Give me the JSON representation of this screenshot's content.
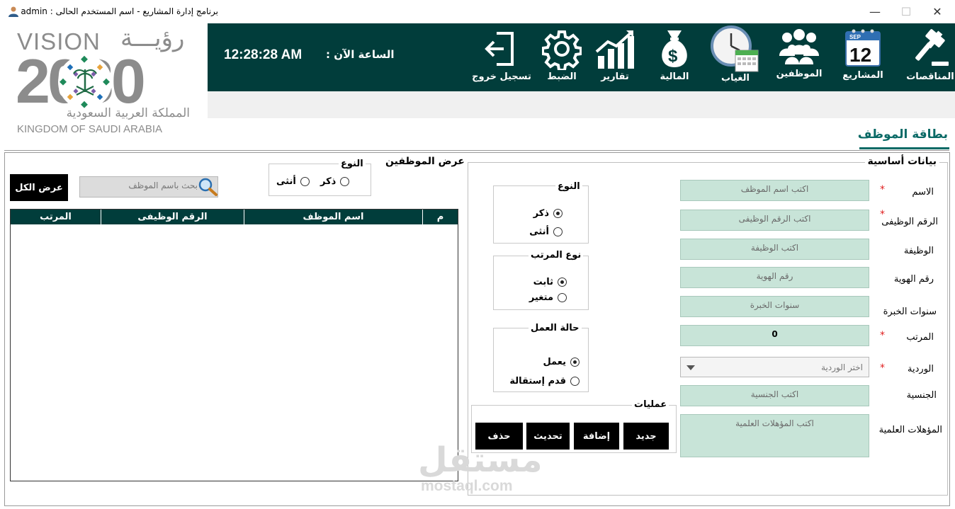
{
  "window": {
    "title": "برنامج إدارة المشاريع   -   اسم المستخدم الحالى  :   admin",
    "minimize": "—",
    "maximize": "☐",
    "close": "✕"
  },
  "toolbar": {
    "items": [
      {
        "label": "المناقصات",
        "icon": "gavel-icon"
      },
      {
        "label": "المشاريع",
        "icon": "calendar-icon"
      },
      {
        "label": "الموظفين",
        "icon": "users-icon"
      },
      {
        "label": "الغياب",
        "icon": "clock-calendar-icon"
      },
      {
        "label": "المالية",
        "icon": "money-bag-icon"
      },
      {
        "label": "تقارير",
        "icon": "chart-icon"
      },
      {
        "label": "الضبط",
        "icon": "gear-icon"
      },
      {
        "label": "تسجيل خروج",
        "icon": "logout-icon"
      }
    ],
    "calendar_month": "SEP",
    "calendar_day": "12",
    "clock_label": "الساعة الآن  :",
    "clock_time": "12:28:28 AM"
  },
  "logo": {
    "line1": "VISION",
    "line1_ar": "رؤيـــة",
    "number": "2030",
    "ar_name": "المملكة العربية السعودية",
    "en_name": "KINGDOM OF SAUDI ARABIA"
  },
  "page_title": "بطاقة الموظف",
  "employee_form": {
    "section_title": "بيانات أساسية",
    "fields": {
      "name": {
        "label": "الاسم",
        "placeholder": "اكتب اسم الموظف",
        "required": true
      },
      "emp_no": {
        "label": "الرقم الوظيفى",
        "placeholder": "اكتب الرقم الوظيفى",
        "required": true
      },
      "job": {
        "label": "الوظيفة",
        "placeholder": "اكتب الوظيفة"
      },
      "id_no": {
        "label": "رقم الهوية",
        "placeholder": "رقم الهوية"
      },
      "experience": {
        "label": "سنوات الخبرة",
        "placeholder": "سنوات الخبرة"
      },
      "salary": {
        "label": "المرتب",
        "value": "0",
        "required": true
      },
      "shift": {
        "label": "الوردية",
        "placeholder": "اختر الوردية",
        "required": true
      },
      "nationality": {
        "label": "الجنسية",
        "placeholder": "اكتب الجنسية"
      },
      "qualifications": {
        "label": "المؤهلات العلمية",
        "placeholder": "اكتب المؤهلات العلمية"
      }
    },
    "required_mark": "*",
    "gender_group": {
      "title": "النوع",
      "male": "ذكر",
      "female": "أنثى",
      "selected": "male"
    },
    "salary_type_group": {
      "title": "نوع المرتب",
      "fixed": "ثابت",
      "variable": "متغير",
      "selected": "fixed"
    },
    "work_status_group": {
      "title": "حالة العمل",
      "working": "يعمل",
      "resigned": "قدم إستقالة",
      "selected": "working"
    },
    "operations": {
      "title": "عمليات",
      "new": "جديد",
      "add": "إضافة",
      "update": "تحديث",
      "delete": "حذف"
    }
  },
  "employee_list": {
    "section_title": "عرض الموظفين",
    "gender_filter": {
      "title": "النوع",
      "male": "ذكر",
      "female": "أنثى"
    },
    "search_placeholder": "بحث باسم الموظف",
    "show_all": "عرض الكل",
    "columns": [
      "م",
      "اسم الموظف",
      "الرقم الوظيفى",
      "المرتب"
    ],
    "rows": []
  },
  "watermark": {
    "ar": "مستقل",
    "en": "mostaql.com"
  },
  "colors": {
    "band": "#013d3b",
    "field": "#c8e4d8",
    "accent": "#0a6a66",
    "required": "#e02020"
  }
}
